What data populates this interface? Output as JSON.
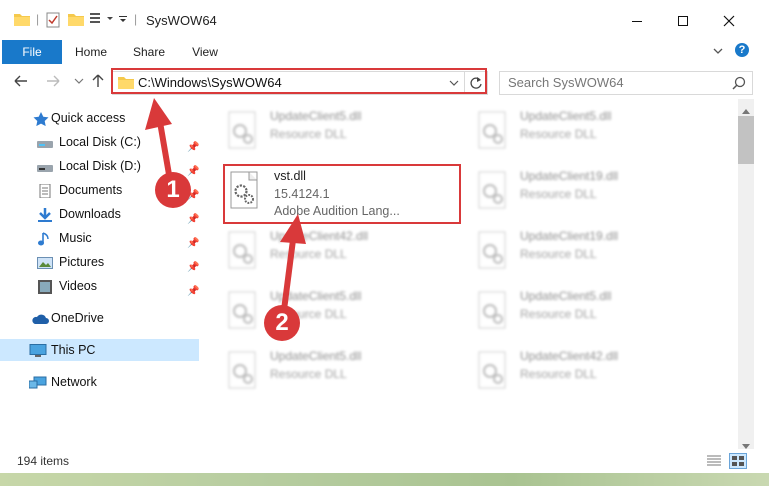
{
  "window": {
    "title": "SysWOW64"
  },
  "ribbon": {
    "tabs": [
      "File",
      "Home",
      "Share",
      "View"
    ]
  },
  "address": {
    "path": "C:\\Windows\\SysWOW64",
    "search_placeholder": "Search SysWOW64"
  },
  "nav": {
    "items": [
      {
        "label": "Quick access",
        "icon": "star-icon"
      },
      {
        "label": "Local Disk (C:)",
        "icon": "drive-icon",
        "pinned": true
      },
      {
        "label": "Local Disk (D:)",
        "icon": "drive-icon",
        "pinned": true
      },
      {
        "label": "Documents",
        "icon": "documents-icon",
        "pinned": true
      },
      {
        "label": "Downloads",
        "icon": "download-icon",
        "pinned": true
      },
      {
        "label": "Music",
        "icon": "music-icon",
        "pinned": true
      },
      {
        "label": "Pictures",
        "icon": "pictures-icon",
        "pinned": true
      },
      {
        "label": "Videos",
        "icon": "videos-icon",
        "pinned": true
      },
      {
        "label": "OneDrive",
        "icon": "cloud-icon"
      },
      {
        "label": "This PC",
        "icon": "computer-icon",
        "selected": true
      },
      {
        "label": "Network",
        "icon": "network-icon"
      }
    ]
  },
  "files": [
    {
      "name": "UpdateClient5.dll",
      "type": "Resource DLL"
    },
    {
      "name": "UpdateClient5.dll",
      "type": "Resource DLL"
    },
    {
      "name": "UpdateClient19.dll",
      "type": "Resource DLL"
    },
    {
      "name": "UpdateClient42.dll",
      "type": "Resource DLL"
    },
    {
      "name": "UpdateClient19.dll",
      "type": "Resource DLL"
    },
    {
      "name": "UpdateClient5.dll",
      "type": "Resource DLL"
    },
    {
      "name": "UpdateClient5.dll",
      "type": "Resource DLL"
    },
    {
      "name": "UpdateClient5.dll",
      "type": "Resource DLL"
    },
    {
      "name": "UpdateClient42.dll",
      "type": "Resource DLL"
    }
  ],
  "highlighted_file": {
    "name": "vst.dll",
    "version": "15.4124.1",
    "description": "Adobe Audition Lang..."
  },
  "status": {
    "item_count": "194 items"
  },
  "annotations": {
    "step1": "1",
    "step2": "2",
    "color": "#d9393a"
  },
  "colors": {
    "accent": "#1979ca",
    "selected_nav": "#cce8ff"
  }
}
